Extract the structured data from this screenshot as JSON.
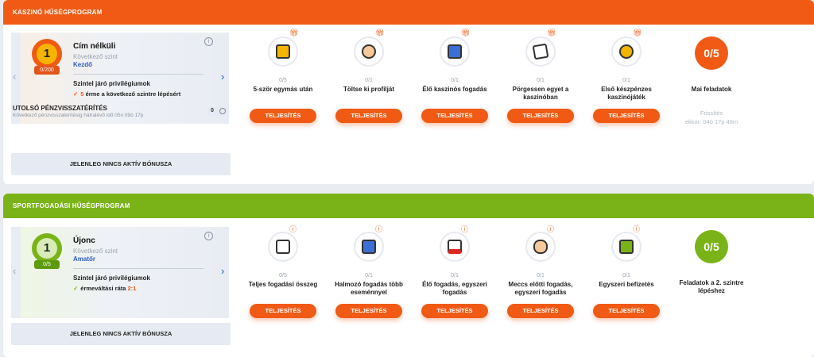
{
  "casino": {
    "title": "KASZINÓ HŰSÉGPROGRAM",
    "accent": "#f05a14",
    "card": {
      "level_number": "1",
      "badge": "0/200",
      "title": "Cím nélküli",
      "next_label": "Következő szint",
      "next_level": "Kezdő",
      "info_icon": "info-icon",
      "privileges_title": "Szintel járó privilégiumok",
      "privilege_prefix": "",
      "privilege_highlight": "5",
      "privilege_suffix": "érme a következő szintre lépésért"
    },
    "cashback": {
      "title": "UTOLSÓ PÉNZVISSZATÉRÍTÉS",
      "subtitle": "Következő pénzvisszatérítésig hátralévő idő 05n 09ó 17p",
      "value": "0"
    },
    "bonus": "JELENLEG NINCS AKTÍV BÓNUSZA",
    "tasks": [
      {
        "icon": "slot-machine-icon",
        "progress": "0/5",
        "label": "5-ször egymás után",
        "button": "TELJESÍTÉS"
      },
      {
        "icon": "profile-icon",
        "progress": "0/1",
        "label": "Töltse ki profilját",
        "button": "TELJESÍTÉS"
      },
      {
        "icon": "live-casino-icon",
        "progress": "0/1",
        "label": "Élő kaszinós fogadás",
        "button": "TELJESÍTÉS"
      },
      {
        "icon": "cards-icon",
        "progress": "0/1",
        "label": "Pörgessen egyet a kaszinóban",
        "button": "TELJESÍTÉS"
      },
      {
        "icon": "coins-icon",
        "progress": "0/1",
        "label": "Első készpénzes kaszinójáték",
        "button": "TELJESÍTÉS"
      }
    ],
    "daily": {
      "value": "0/5",
      "label": "Mai feladatok",
      "refresh_label": "Frissítés",
      "refresh_time": "ekkor: 04ó 17p 46m"
    }
  },
  "sport": {
    "title": "SPORTFOGADÁSI HŰSÉGPROGRAM",
    "accent": "#7ab317",
    "card": {
      "level_number": "1",
      "badge": "0/5",
      "title": "Újonc",
      "next_label": "Következő szint",
      "next_level": "Amatőr",
      "privileges_title": "Szintel járó privilégiumok",
      "privilege_prefix": "",
      "privilege_highlight": "2:1",
      "privilege_suffix": "érmeváltási ráta"
    },
    "bonus": "JELENLEG NINCS AKTÍV BÓNUSZA",
    "tasks": [
      {
        "icon": "bet-slip-icon",
        "progress": "0/5",
        "label": "Teljes fogadási összeg",
        "button": "TELJESÍTÉS"
      },
      {
        "icon": "accumulator-icon",
        "progress": "0/1",
        "label": "Halmozó fogadás több eseménnyel",
        "button": "TELJESÍTÉS"
      },
      {
        "icon": "live-bet-icon",
        "progress": "0/1",
        "label": "Élő fogadás, egyszeri fogadás",
        "button": "TELJESÍTÉS"
      },
      {
        "icon": "handshake-icon",
        "progress": "0/1",
        "label": "Meccs előtti fogadás, egyszeri fogadás",
        "button": "TELJESÍTÉS"
      },
      {
        "icon": "wallet-icon",
        "progress": "0/1",
        "label": "Egyszeri befizetés",
        "button": "TELJESÍTÉS"
      }
    ],
    "daily": {
      "value": "0/5",
      "label": "Feladatok a 2. szintre lépéshez"
    }
  }
}
